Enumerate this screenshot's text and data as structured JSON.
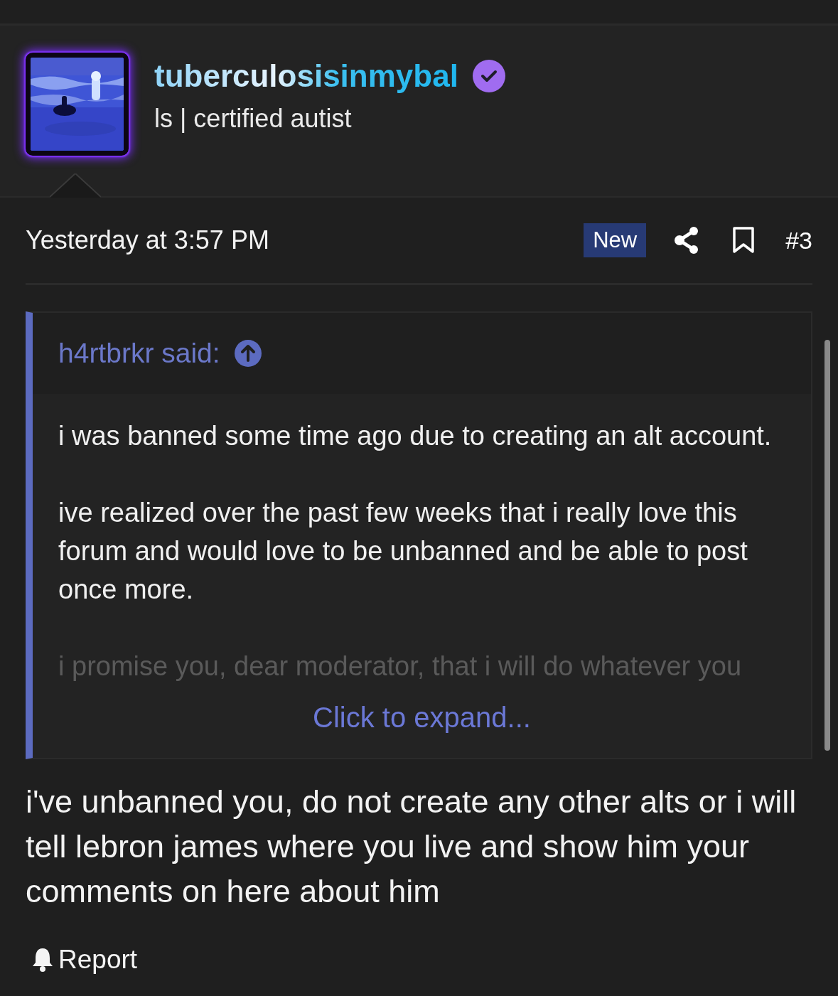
{
  "user": {
    "name": "tuberculosisinmybal",
    "verified": true,
    "title": "ls | certified autist"
  },
  "post": {
    "date": "Yesterday at 3:57 PM",
    "badge": "New",
    "number": "#3"
  },
  "quote": {
    "author": "h4rtbrkr said:",
    "paragraphs": [
      {
        "text": "i was banned some time ago due to creating an alt account.",
        "faded": false
      },
      {
        "text": "ive realized over the past few weeks that i really love this forum and would love to be unbanned and be able to post once more.",
        "faded": false
      },
      {
        "text": "i promise you, dear moderator, that i will do whatever you",
        "faded": true
      }
    ],
    "expand_link": "Click to expand..."
  },
  "reply": "i've unbanned you, do not create any other alts or i will tell lebron james where you live and show him your comments on here about him",
  "report": "Report"
}
